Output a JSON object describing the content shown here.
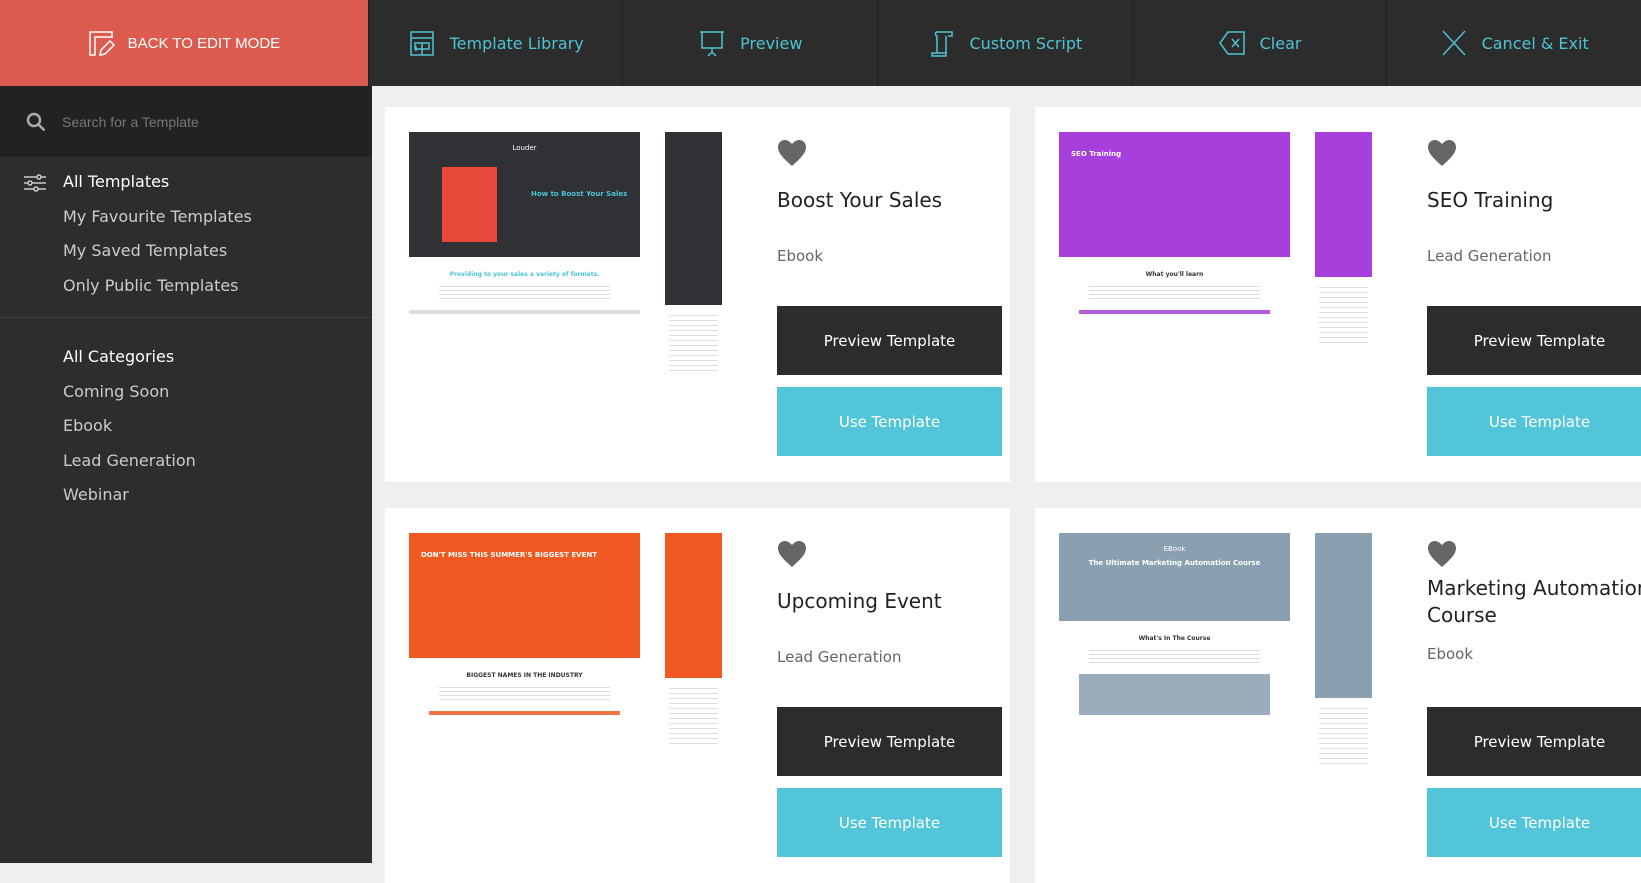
{
  "topbar": {
    "back_label": "BACK TO EDIT MODE",
    "nav": [
      {
        "label": "Template Library",
        "icon": "store-icon"
      },
      {
        "label": "Preview",
        "icon": "presentation-icon"
      },
      {
        "label": "Custom Script",
        "icon": "scroll-icon"
      },
      {
        "label": "Clear",
        "icon": "backspace-icon"
      },
      {
        "label": "Cancel & Exit",
        "icon": "close-icon"
      }
    ],
    "accent": "#4fc3d4",
    "back_color": "#db5c4e"
  },
  "sidebar": {
    "search_placeholder": "Search for a Template",
    "filters": [
      "All Templates",
      "My Favourite Templates",
      "My Saved Templates",
      "Only Public Templates"
    ],
    "categories": [
      "All Categories",
      "Coming Soon",
      "Ebook",
      "Lead Generation",
      "Webinar"
    ]
  },
  "templates": [
    {
      "title": "Boost Your Sales",
      "category": "Ebook",
      "preview": "Preview Template",
      "use": "Use Template",
      "theme": "#2f3134",
      "thumb_title": "How to Boost Your Sales",
      "thumb_brand": "Louder",
      "thumb_tagline": "Providing to your sales a variety of formats."
    },
    {
      "title": "SEO Training",
      "category": "Lead Generation",
      "preview": "Preview Template",
      "use": "Use Template",
      "theme": "#a63fdc",
      "thumb_title": "SEO Training",
      "thumb_brand": "",
      "thumb_tagline": "What you'll learn"
    },
    {
      "title": "Upcoming Event",
      "category": "Lead Generation",
      "preview": "Preview Template",
      "use": "Use Template",
      "theme": "#f05a22",
      "thumb_title": "DON'T MISS THIS SUMMER'S BIGGEST EVENT",
      "thumb_brand": "",
      "thumb_tagline": "BIGGEST NAMES IN THE INDUSTRY"
    },
    {
      "title": "Marketing Automation Course",
      "category": "Ebook",
      "preview": "Preview Template",
      "use": "Use Template",
      "theme": "#8a9fb0",
      "thumb_title": "The Ultimate Marketing Automation Course",
      "thumb_brand": "EBook",
      "thumb_tagline": "What's In The Course"
    }
  ]
}
